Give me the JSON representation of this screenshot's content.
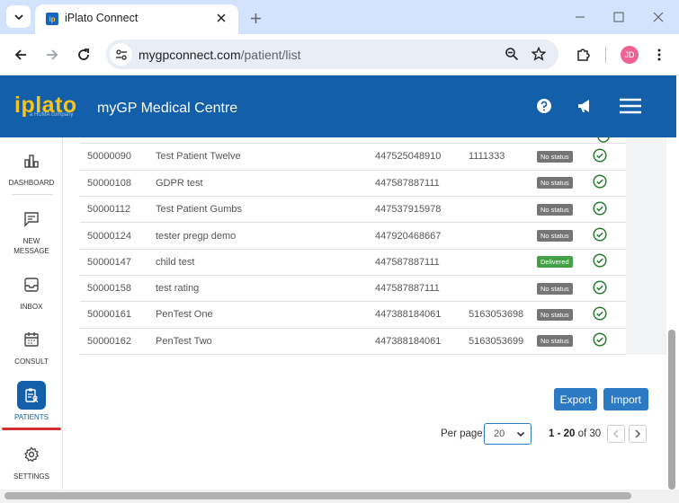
{
  "browser": {
    "tab_title": "iPlato Connect",
    "url_domain": "mygpconnect.com",
    "url_path": "/patient/list",
    "profile_initials": "JD"
  },
  "app": {
    "logo_text": "iplato",
    "logo_subtext": "a HUMA company",
    "title": "myGP Medical Centre",
    "header_color": "#135faa",
    "logo_color": "#f8c41c"
  },
  "sidebar": {
    "items": [
      {
        "label": "DASHBOARD",
        "icon": "bar-chart-icon"
      },
      {
        "label": "NEW MESSAGE",
        "icon": "message-icon"
      },
      {
        "label": "INBOX",
        "icon": "inbox-icon"
      },
      {
        "label": "CONSULT",
        "icon": "calendar-icon"
      },
      {
        "label": "PATIENTS",
        "icon": "patients-icon",
        "active": true
      },
      {
        "label": "SETTINGS",
        "icon": "gear-icon"
      }
    ]
  },
  "patients": {
    "rows": [
      {
        "id": "50000090",
        "name": "Test Patient Twelve",
        "phone": "447525048910",
        "nhs": "1111333",
        "status": "No status"
      },
      {
        "id": "50000108",
        "name": "GDPR test",
        "phone": "447587887111",
        "nhs": "",
        "status": "No status"
      },
      {
        "id": "50000112",
        "name": "Test Patient Gumbs",
        "phone": "447537915978",
        "nhs": "",
        "status": "No status"
      },
      {
        "id": "50000124",
        "name": "tester pregp demo",
        "phone": "447920468667",
        "nhs": "",
        "status": "No status"
      },
      {
        "id": "50000147",
        "name": "child test",
        "phone": "447587887111",
        "nhs": "",
        "status": "Delivered"
      },
      {
        "id": "50000158",
        "name": "test rating",
        "phone": "447587887111",
        "nhs": "",
        "status": "No status"
      },
      {
        "id": "50000161",
        "name": "PenTest One",
        "phone": "447388184061",
        "nhs": "5163053698",
        "status": "No status"
      },
      {
        "id": "50000162",
        "name": "PenTest Two",
        "phone": "447388184061",
        "nhs": "5163053699",
        "status": "No status"
      }
    ]
  },
  "actions": {
    "export_label": "Export",
    "import_label": "Import"
  },
  "pagination": {
    "per_page_label": "Per page:",
    "per_page_value": "20",
    "range_bold": "1 - 20",
    "range_of": "of 30"
  },
  "colors": {
    "accent": "#2d7ac4",
    "delivered": "#43a047",
    "no_status": "#757575",
    "active_indicator": "#d32f2f"
  }
}
